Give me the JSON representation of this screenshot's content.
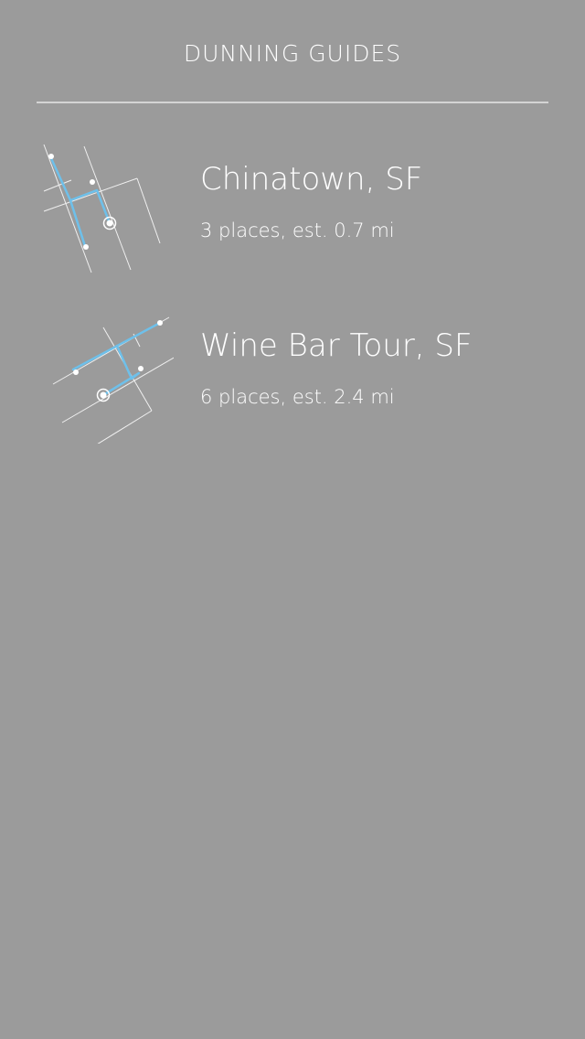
{
  "header": {
    "title": "DUNNING GUIDES"
  },
  "guides": [
    {
      "name": "Chinatown, SF",
      "meta": "3 places, est. 0.7 mi",
      "map_icon": "route-map-icon",
      "route_color": "#6ec0ea"
    },
    {
      "name": "Wine Bar Tour, SF",
      "meta": "6 places, est. 2.4 mi",
      "map_icon": "route-map-icon",
      "route_color": "#6ec0ea"
    }
  ],
  "colors": {
    "background": "#9b9b9b",
    "text": "#ffffff",
    "divider": "#d4d4d4",
    "route": "#6ec0ea"
  }
}
